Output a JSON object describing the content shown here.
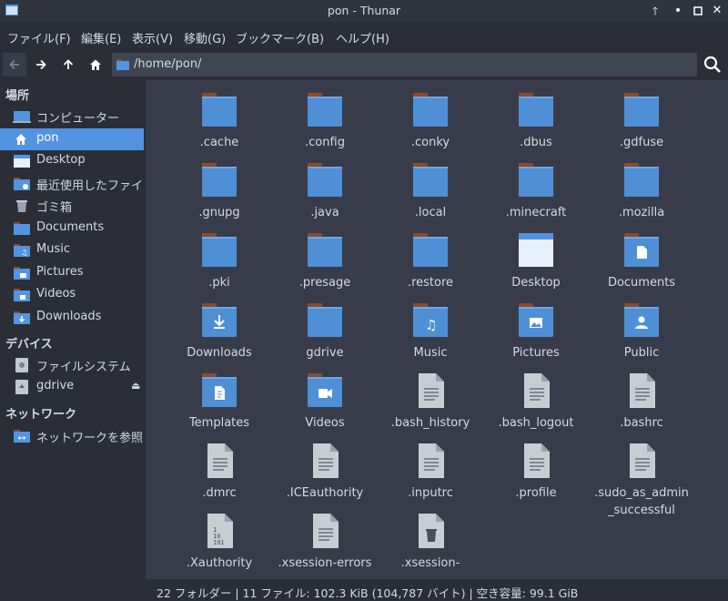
{
  "window": {
    "title": "pon - Thunar"
  },
  "menubar": [
    {
      "label": "ファイル(F)"
    },
    {
      "label": "編集(E)"
    },
    {
      "label": "表示(V)"
    },
    {
      "label": "移動(G)"
    },
    {
      "label": "ブックマーク(B)"
    },
    {
      "label": "ヘルプ(H)"
    }
  ],
  "location": {
    "path": "/home/pon/"
  },
  "sidebar": {
    "places_heading": "場所",
    "places": [
      {
        "label": "コンピューター",
        "icon": "computer-icon"
      },
      {
        "label": "pon",
        "icon": "home-icon"
      },
      {
        "label": "Desktop",
        "icon": "desktop-folder-icon"
      },
      {
        "label": "最近使用したファイル",
        "icon": "recent-folder-icon"
      },
      {
        "label": "ゴミ箱",
        "icon": "trash-icon"
      },
      {
        "label": "Documents",
        "icon": "folder-icon"
      },
      {
        "label": "Music",
        "icon": "folder-music-icon"
      },
      {
        "label": "Pictures",
        "icon": "folder-pictures-icon"
      },
      {
        "label": "Videos",
        "icon": "folder-videos-icon"
      },
      {
        "label": "Downloads",
        "icon": "folder-downloads-icon"
      }
    ],
    "devices_heading": "デバイス",
    "devices": [
      {
        "label": "ファイルシステム",
        "icon": "drive-icon"
      },
      {
        "label": "gdrive",
        "icon": "removable-drive-icon"
      }
    ],
    "network_heading": "ネットワーク",
    "network": [
      {
        "label": "ネットワークを参照",
        "icon": "network-folder-icon"
      }
    ]
  },
  "files": [
    {
      "name": ".cache",
      "type": "folder"
    },
    {
      "name": ".config",
      "type": "folder"
    },
    {
      "name": ".conky",
      "type": "folder"
    },
    {
      "name": ".dbus",
      "type": "folder"
    },
    {
      "name": ".gdfuse",
      "type": "folder"
    },
    {
      "name": ".gnupg",
      "type": "folder"
    },
    {
      "name": ".java",
      "type": "folder"
    },
    {
      "name": ".local",
      "type": "folder"
    },
    {
      "name": ".minecraft",
      "type": "folder"
    },
    {
      "name": ".mozilla",
      "type": "folder"
    },
    {
      "name": ".pki",
      "type": "folder"
    },
    {
      "name": ".presage",
      "type": "folder"
    },
    {
      "name": ".restore",
      "type": "folder"
    },
    {
      "name": "Desktop",
      "type": "desktop"
    },
    {
      "name": "Documents",
      "type": "documents"
    },
    {
      "name": "Downloads",
      "type": "downloads"
    },
    {
      "name": "gdrive",
      "type": "folder"
    },
    {
      "name": "Music",
      "type": "music"
    },
    {
      "name": "Pictures",
      "type": "pictures"
    },
    {
      "name": "Public",
      "type": "public"
    },
    {
      "name": "Templates",
      "type": "templates"
    },
    {
      "name": "Videos",
      "type": "videos"
    },
    {
      "name": ".bash_history",
      "type": "text"
    },
    {
      "name": ".bash_logout",
      "type": "text"
    },
    {
      "name": ".bashrc",
      "type": "text"
    },
    {
      "name": ".dmrc",
      "type": "text"
    },
    {
      "name": ".ICEauthority",
      "type": "text"
    },
    {
      "name": ".inputrc",
      "type": "text"
    },
    {
      "name": ".profile",
      "type": "text"
    },
    {
      "name": ".sudo_as_admin_successful",
      "type": "text",
      "display": ".sudo_as_admin\n_successful"
    },
    {
      "name": ".Xauthority",
      "type": "binary"
    },
    {
      "name": ".xsession-errors",
      "type": "text"
    },
    {
      "name": ".xsession-errors.old",
      "type": "trash",
      "display": ".xsession-"
    }
  ],
  "statusbar": {
    "text": "22 フォルダー  |  11 ファイル: 102.3 KiB (104,787 バイト)  |  空き容量: 99.1 GiB"
  },
  "colors": {
    "accent": "#5294e2",
    "folder_blue": "#4f8fd6",
    "folder_tab": "#8b4a2b"
  }
}
